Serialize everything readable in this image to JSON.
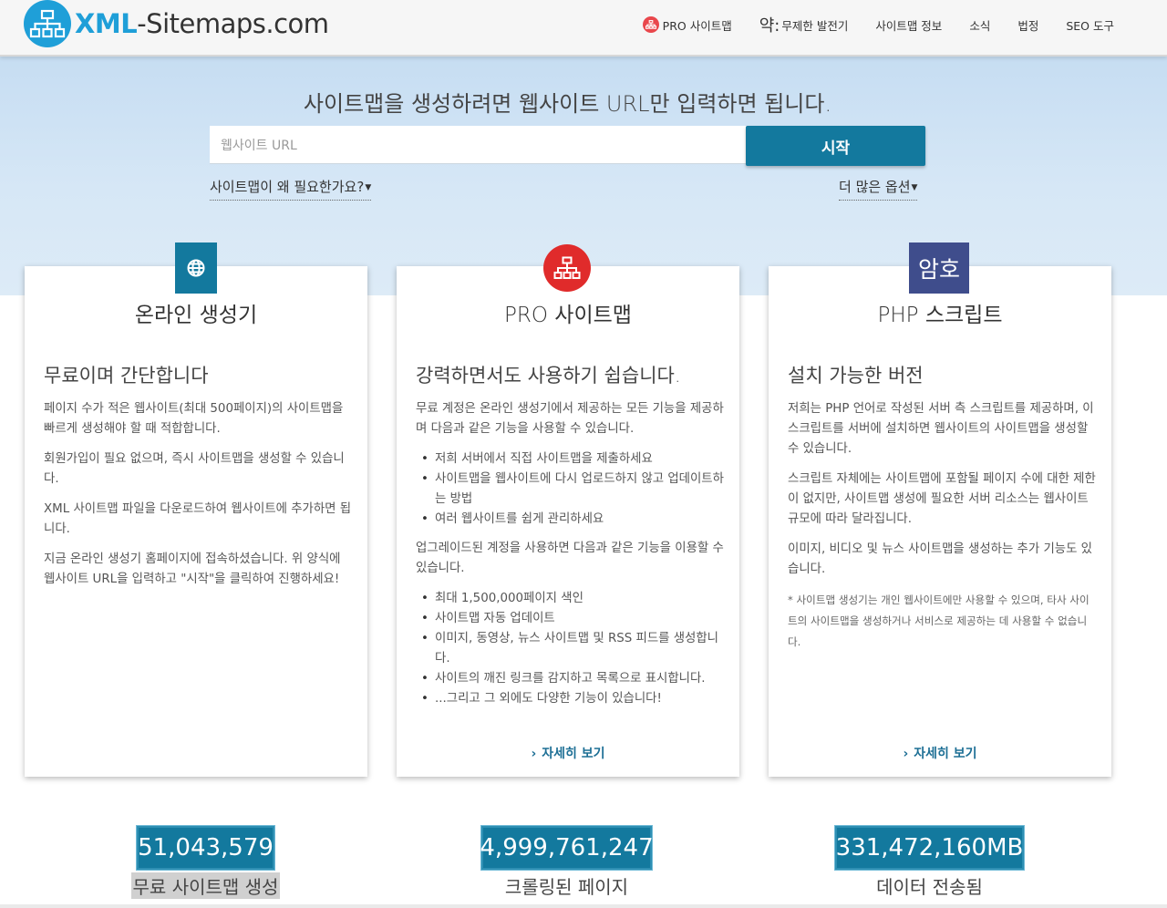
{
  "header": {
    "logo_brand": "XML",
    "logo_rest": "-Sitemaps.com",
    "nav": [
      {
        "label": "PRO 사이트맵"
      },
      {
        "prefix": "약:",
        "label": "무제한 발전기"
      },
      {
        "label": "사이트맵 정보"
      },
      {
        "label": "소식"
      },
      {
        "label": "법정"
      },
      {
        "label": "SEO 도구"
      }
    ]
  },
  "hero": {
    "title": "사이트맵을 생성하려면 웹사이트 URL만 입력하면 됩니다.",
    "input_placeholder": "웹사이트 URL",
    "start_label": "시작",
    "why_link": "사이트맵이 왜 필요한가요?",
    "more_options": "더 많은 옵션"
  },
  "cards": [
    {
      "badge": "globe-icon",
      "title": "온라인 생성기",
      "subtitle": "무료이며 간단합니다",
      "p1": "페이지 수가 적은 웹사이트(최대 500페이지)의 사이트맵을 빠르게 생성해야 할 때 적합합니다.",
      "p2": "회원가입이 필요 없으며, 즉시 사이트맵을 생성할 수 있습니다.",
      "p3": "XML 사이트맵 파일을 다운로드하여 웹사이트에 추가하면 됩니다.",
      "p4": "지금 온라인 생성기 홈페이지에 접속하셨습니다. 위 양식에 웹사이트 URL을 입력하고 \"시작\"을 클릭하여 진행하세요!"
    },
    {
      "badge": "sitemap-icon",
      "title": "PRO 사이트맵",
      "subtitle": "강력하면서도 사용하기 쉽습니다.",
      "p1": "무료 계정은 온라인 생성기에서 제공하는 모든 기능을 제공하며 다음과 같은 기능을 사용할 수 있습니다.",
      "list1": [
        "저희 서버에서 직접 사이트맵을 제출하세요",
        "사이트맵을 웹사이트에 다시 업로드하지 않고 업데이트하는 방법",
        "여러 웹사이트를 쉽게 관리하세요"
      ],
      "p2": "업그레이드된 계정을 사용하면 다음과 같은 기능을 이용할 수 있습니다.",
      "list2": [
        "최대 1,500,000페이지 색인",
        "사이트맵 자동 업데이트",
        "이미지, 동영상, 뉴스 사이트맵 및 RSS 피드를 생성합니다.",
        "사이트의 깨진 링크를 감지하고 목록으로 표시합니다.",
        "...그리고 그 외에도 다양한 기능이 있습니다!"
      ],
      "more": "자세히 보기"
    },
    {
      "badge_text": "암호",
      "title": "PHP 스크립트",
      "subtitle": "설치 가능한 버전",
      "p1": "저희는 PHP 언어로 작성된 서버 측 스크립트를 제공하며, 이 스크립트를 서버에 설치하면 웹사이트의 사이트맵을 생성할 수 있습니다.",
      "p2": "스크립트 자체에는 사이트맵에 포함될 페이지 수에 대한 제한이 없지만, 사이트맵 생성에 필요한 서버 리소스는 웹사이트 규모에 따라 달라집니다.",
      "p3": "이미지, 비디오 및 뉴스 사이트맵을 생성하는 추가 기능도 있습니다.",
      "note": "* 사이트맵 생성기는 개인 웹사이트에만 사용할 수 있으며, 타사 사이트의 사이트맵을 생성하거나 서비스로 제공하는 데 사용할 수 없습니다.",
      "more": "자세히 보기"
    }
  ],
  "stats": [
    {
      "value": "51,043,579",
      "label": "무료 사이트맵 생성"
    },
    {
      "value": "4,999,761,247",
      "label": "크롤링된 페이지"
    },
    {
      "value": "331,472,160MB",
      "label": "데이터 전송됨"
    }
  ],
  "colors": {
    "brand": "#1f9fd8",
    "primary": "#13799e",
    "pro_red": "#e02b2b",
    "php_purple": "#3f4d8c"
  }
}
